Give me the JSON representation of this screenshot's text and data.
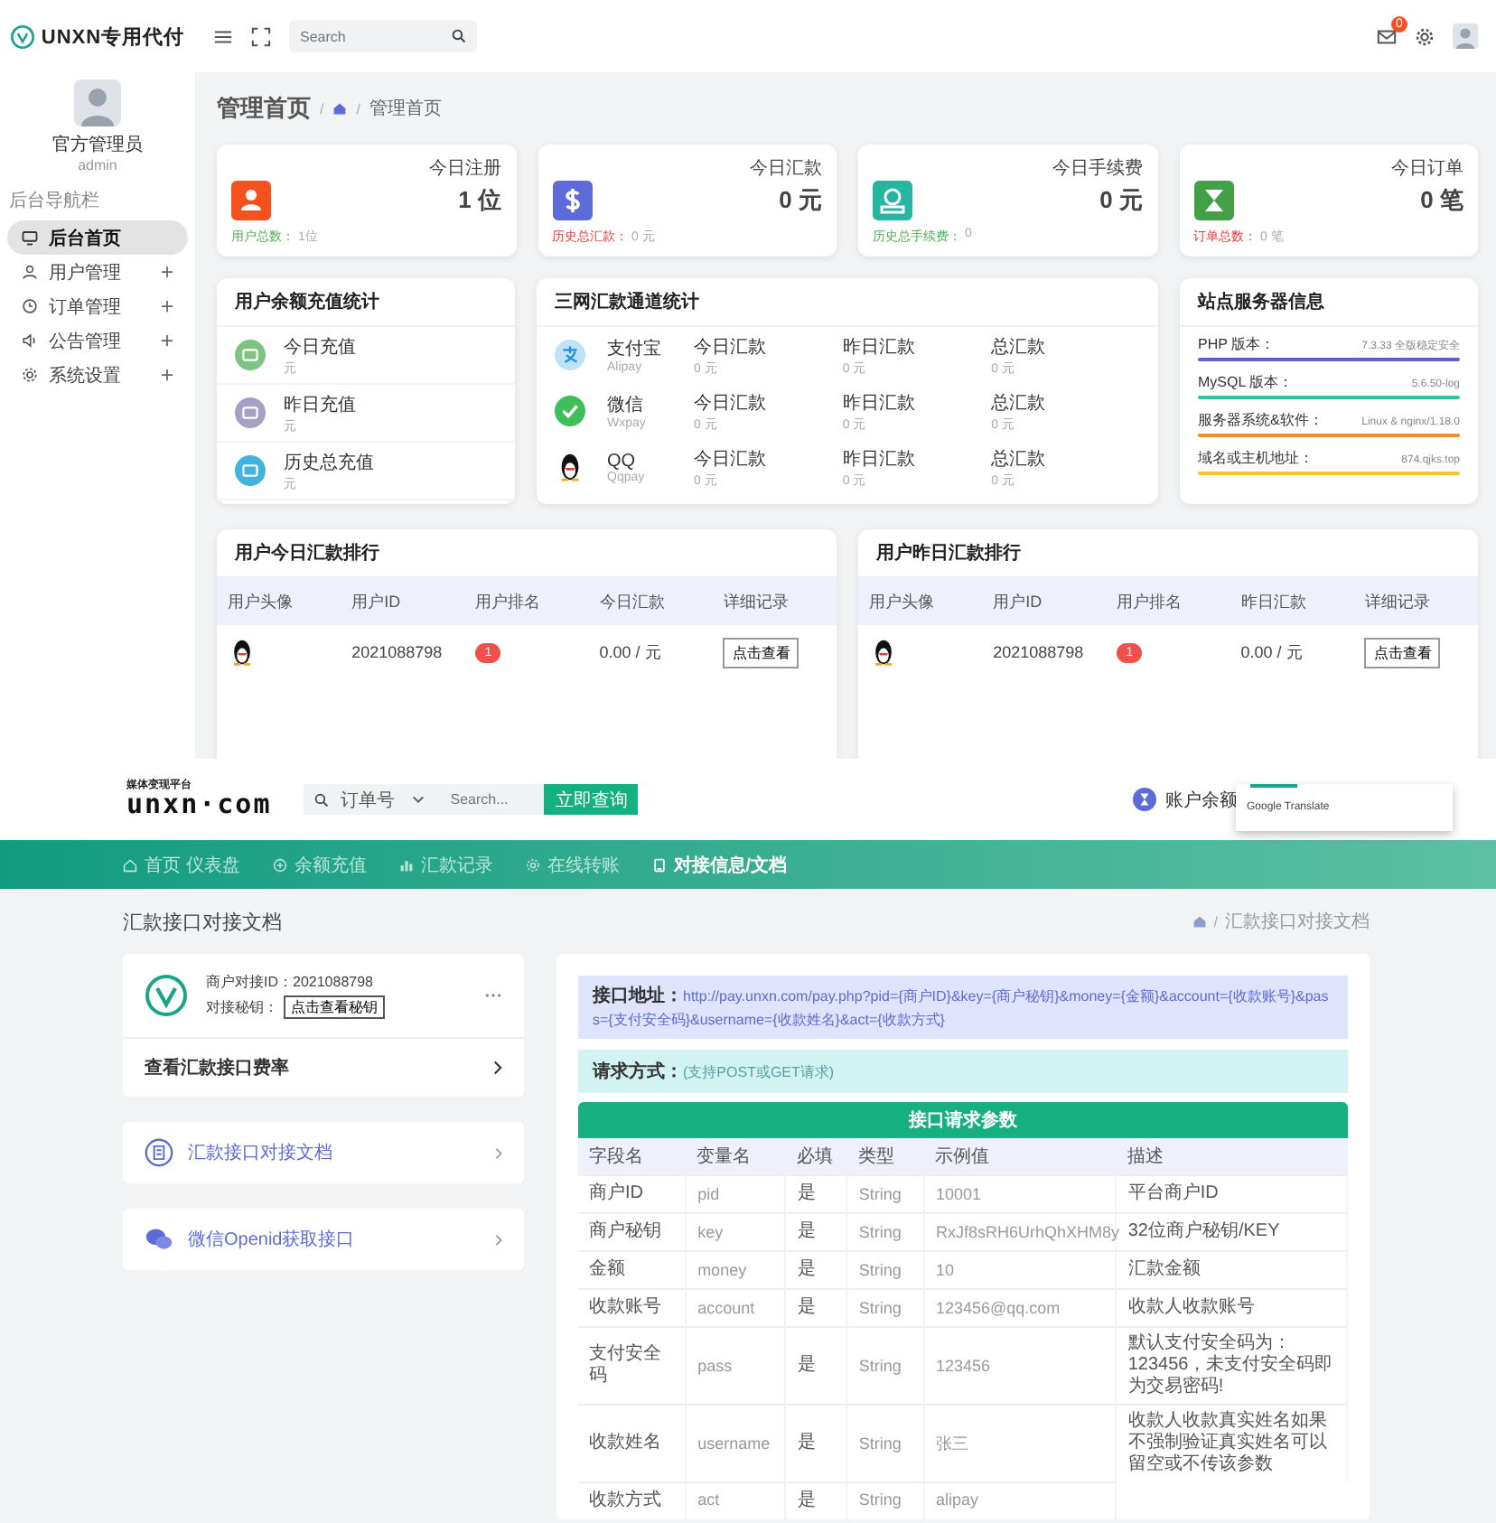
{
  "top": {
    "logo": "UNXN专用代付",
    "search_placeholder": "Search",
    "mail_count": "0",
    "user": {
      "name": "官方管理员",
      "role": "admin"
    },
    "nav_heading": "后台导航栏",
    "nav": [
      {
        "label": "后台首页",
        "kind": "monitor",
        "selected": true,
        "expandable": false
      },
      {
        "label": "用户管理",
        "kind": "user",
        "selected": false,
        "expandable": true
      },
      {
        "label": "订单管理",
        "kind": "clock",
        "selected": false,
        "expandable": true
      },
      {
        "label": "公告管理",
        "kind": "speaker",
        "selected": false,
        "expandable": true
      },
      {
        "label": "系统设置",
        "kind": "gear",
        "selected": false,
        "expandable": true
      }
    ],
    "page_title": "管理首页",
    "breadcrumb_separators": [
      "/",
      "/"
    ],
    "breadcrumb": "管理首页",
    "stat_cards": [
      {
        "title": "今日注册",
        "value": "1 位",
        "kind": "user",
        "color": "#f4511e",
        "footer": {
          "label": "用户总数：",
          "value": "1位",
          "color": "#4caf50"
        }
      },
      {
        "title": "今日汇款",
        "value": "0 元",
        "kind": "dollar",
        "color": "#5c6bd8",
        "footer": {
          "label": "历史总汇款：",
          "value": "0 元",
          "color": "#e53935"
        }
      },
      {
        "title": "今日手续费",
        "value": "0 元",
        "kind": "bag",
        "color": "#26b5a0",
        "footer": {
          "label": "历史总手续费：",
          "value": "0",
          "color": "#4caf50"
        }
      },
      {
        "title": "今日订单",
        "value": "0 笔",
        "kind": "hourglass",
        "color": "#43a047",
        "footer": {
          "label": "订单总数：",
          "value": "0 笔",
          "color": "#e53935"
        }
      }
    ],
    "balance": {
      "title": "用户余额充值统计",
      "items": [
        {
          "label": "今日充值",
          "value": "元",
          "color": "#7cc47f"
        },
        {
          "label": "昨日充值",
          "value": "元",
          "color": "#a79fc4"
        },
        {
          "label": "历史总充值",
          "value": "元",
          "color": "#3fb4e0"
        }
      ]
    },
    "channels": {
      "title": "三网汇款通道统计",
      "rows": [
        {
          "name": "支付宝",
          "code": "Alipay",
          "kind": "alipay",
          "cells": [
            {
              "label": "今日汇款",
              "value": "0 元"
            },
            {
              "label": "昨日汇款",
              "value": "0 元"
            },
            {
              "label": "总汇款",
              "value": "0 元"
            }
          ]
        },
        {
          "name": "微信",
          "code": "Wxpay",
          "kind": "wechat",
          "cells": [
            {
              "label": "今日汇款",
              "value": "0 元"
            },
            {
              "label": "昨日汇款",
              "value": "0 元"
            },
            {
              "label": "总汇款",
              "value": "0 元"
            }
          ]
        },
        {
          "name": "QQ",
          "code": "Qqpay",
          "kind": "qq",
          "cells": [
            {
              "label": "今日汇款",
              "value": "0 元"
            },
            {
              "label": "昨日汇款",
              "value": "0 元"
            },
            {
              "label": "总汇款",
              "value": "0 元"
            }
          ]
        }
      ]
    },
    "server": {
      "title": "站点服务器信息",
      "items": [
        {
          "label": "PHP 版本：",
          "value": "7.3.33 全版稳定安全",
          "color": "#5b5fc7"
        },
        {
          "label": "MySQL 版本：",
          "value": "5.6.50-log",
          "color": "#2ec4a0"
        },
        {
          "label": "服务器系统&软件：",
          "value": "Linux & nginx/1.18.0",
          "color": "#f08c2e"
        },
        {
          "label": "域名或主机地址：",
          "value": "874.qjks.top",
          "color": "#f4c430"
        }
      ]
    },
    "rankings": [
      {
        "title": "用户今日汇款排行",
        "columns": [
          "用户头像",
          "用户ID",
          "用户排名",
          "今日汇款",
          "详细记录"
        ],
        "rows": [
          {
            "user_id": "2021088798",
            "rank": "1",
            "amount": "0.00 / 元",
            "action": "点击查看"
          }
        ]
      },
      {
        "title": "用户昨日汇款排行",
        "columns": [
          "用户头像",
          "用户ID",
          "用户排名",
          "昨日汇款",
          "详细记录"
        ],
        "rows": [
          {
            "user_id": "2021088798",
            "rank": "1",
            "amount": "0.00 / 元",
            "action": "点击查看"
          }
        ]
      }
    ]
  },
  "bottom": {
    "brand_tagline": "媒体变现平台",
    "brand": "unxn·com",
    "search_field": "订单号",
    "search_placeholder": "Search...",
    "search_button": "立即查询",
    "account_label": "账户余额",
    "translate_popup": "Google Translate",
    "nav": [
      {
        "label": "首页  仪表盘",
        "kind": "home",
        "selected": false
      },
      {
        "label": "余额充值",
        "kind": "plus",
        "selected": false
      },
      {
        "label": "汇款记录",
        "kind": "chart",
        "selected": false
      },
      {
        "label": "在线转账",
        "kind": "gear",
        "selected": false
      },
      {
        "label": "对接信息/文档",
        "kind": "book",
        "selected": true
      }
    ],
    "page_title": "汇款接口对接文档",
    "breadcrumb_separator": "/",
    "breadcrumb": "汇款接口对接文档",
    "merchant": {
      "id_label": "商户对接ID：",
      "id": "2021088798",
      "key_label": "对接秘钥：",
      "key_button": "点击查看秘钥",
      "rate_link": "查看汇款接口费率"
    },
    "links": [
      {
        "label": "汇款接口对接文档",
        "kind": "doc"
      },
      {
        "label": "微信Openid获取接口",
        "kind": "wechat"
      }
    ],
    "api_address": "**接口地址：**http://pay.unxn.com/pay.php?pid={商户ID}&key={商户秘钥}&money={金额}&account={收款账号}&pass={支付安全码}&username={收款姓名}&act={收款方式}",
    "method": "**请求方式：**(支持POST或GET请求)",
    "params_title": "接口请求参数",
    "params_columns": [
      "字段名",
      "变量名",
      "必填",
      "类型",
      "示例值",
      "描述"
    ],
    "params": [
      [
        "商户ID",
        "pid",
        "是",
        "String",
        "10001",
        "平台商户ID"
      ],
      [
        "商户秘钥",
        "key",
        "是",
        "String",
        "RxJf8sRH6UrhQhXHM8y",
        "32位商户秘钥/KEY"
      ],
      [
        "金额",
        "money",
        "是",
        "String",
        "10",
        "汇款金额"
      ],
      [
        "收款账号",
        "account",
        "是",
        "String",
        "123456@qq.com",
        "收款人收款账号"
      ],
      [
        "支付安全码",
        "pass",
        "是",
        "String",
        "123456",
        "默认支付安全码为：123456，未支付安全码即为交易密码!"
      ],
      [
        "收款姓名",
        "username",
        "是",
        "String",
        "张三",
        "收款人收款真实姓名如果不强制验证真实姓名可以留空或不传该参数"
      ],
      [
        "收款方式",
        "act",
        "是",
        "String",
        "alipay"
      ]
    ]
  }
}
